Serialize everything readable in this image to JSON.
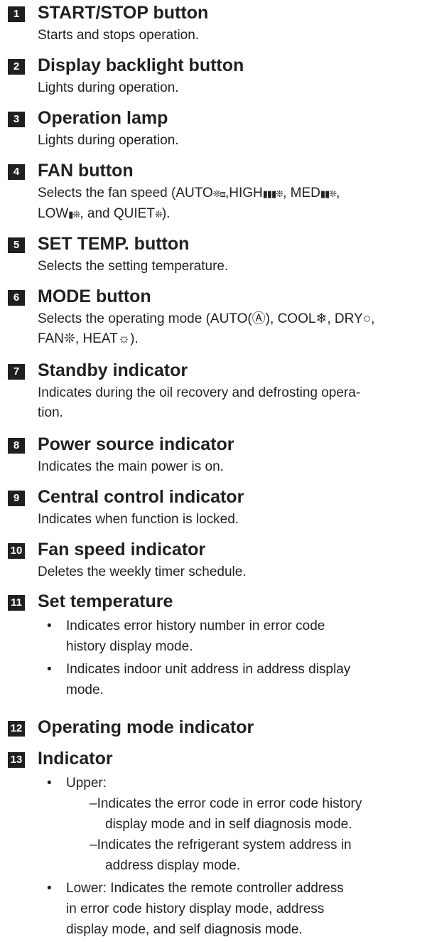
{
  "items": [
    {
      "num": "1",
      "title": "START/STOP button",
      "desc": [
        "Starts and stops operation."
      ]
    },
    {
      "num": "2",
      "title": "Display backlight button",
      "desc": [
        "Lights during operation."
      ]
    },
    {
      "num": "3",
      "title": "Operation lamp",
      "desc": [
        "Lights during operation."
      ]
    },
    {
      "num": "4",
      "title": "FAN button",
      "fan_line1_pre": "Selects the fan speed (AUTO",
      "fan_sym_auto": "❊⧈",
      "fan_line1_mid": ",HIGH",
      "fan_sym_high": "▮▮▮❊",
      "fan_line1_med": ", MED",
      "fan_sym_med": "▮▮❊",
      "fan_line1_end": ",",
      "fan_line2_low": "LOW",
      "fan_sym_low": "▮❊",
      "fan_line2_mid": ", and QUIET",
      "fan_sym_quiet": "❊",
      "fan_line2_end": ")."
    },
    {
      "num": "5",
      "title": "SET TEMP. button",
      "desc": [
        "Selects the setting temperature."
      ]
    },
    {
      "num": "6",
      "title": "MODE button",
      "mode_line1": "Selects the operating mode (AUTO(Ⓐ), COOL❄, DRY○,",
      "mode_line2": "FAN❊, HEAT☼)."
    },
    {
      "num": "7",
      "title": "Standby indicator",
      "desc": [
        "Indicates during the oil recovery and defrosting opera-",
        "tion."
      ]
    },
    {
      "num": "8",
      "title": "Power source indicator",
      "desc": [
        "Indicates the main power is on."
      ]
    },
    {
      "num": "9",
      "title": "Central control indicator",
      "desc": [
        "Indicates when function is locked."
      ]
    },
    {
      "num": "10",
      "title": "Fan speed indicator",
      "desc": [
        "Deletes the weekly timer schedule."
      ]
    },
    {
      "num": "11",
      "title": "Set temperature",
      "bullets": [
        [
          "Indicates error history number in error code",
          "history display mode."
        ],
        [
          "Indicates indoor unit address in address display",
          "mode."
        ]
      ]
    },
    {
      "num": "12",
      "title": "Operating mode indicator"
    },
    {
      "num": "13",
      "title": "Indicator",
      "upper_label": "Upper:",
      "upper_subs": [
        [
          "–Indicates the error code in error code history",
          "display mode and in self diagnosis mode."
        ],
        [
          "–Indicates the refrigerant system address in",
          "address display mode."
        ]
      ],
      "lower_lines": [
        "Lower: Indicates the remote controller address",
        "in error code history display mode, address",
        "display mode, and self diagnosis mode."
      ]
    }
  ],
  "bullet_char": "•"
}
